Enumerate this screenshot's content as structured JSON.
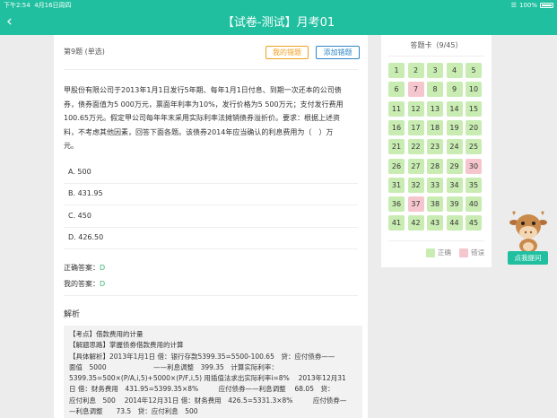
{
  "status": {
    "time": "下午2:54",
    "date": "4月16日周四",
    "battery": "100%"
  },
  "nav": {
    "back": "‹",
    "title": "【试卷-测试】月考01"
  },
  "question": {
    "number": "第9题 (单选)",
    "wrong_button": "我的错题",
    "add_button": "添加错题",
    "stem_lines": [
      "甲股份有限公司于2013年1月1日发行5年期、每年1月1日付息、到期一次还本的公司债",
      "券，债券面值为5 000万元，票面年利率为10%，发行价格为5 500万元；支付发行费用",
      "100.65万元。假定甲公司每年年末采用实际利率法摊销债券溢折价。要求：根据上述资",
      "料，不考虑其他因素，回答下面各题。该债券2014年应当确认的利息费用为（　）万",
      "元。"
    ],
    "options": [
      "A. 500",
      "B. 431.95",
      "C. 450",
      "D. 426.50"
    ],
    "correct_label": "正确答案：",
    "correct_value": "D",
    "mine_label": "我的答案：",
    "mine_value": "D"
  },
  "analysis": {
    "title": "解析",
    "lines": [
      "【考点】借款费用的计量",
      "【解题思路】掌握债券借款费用的计算",
      "【具体解析】2013年1月1日 借：银行存款5399.35=5500-100.65　贷：应付债券——",
      "面值　5000　　　　　　　——利息调整　399.35　计算实际利率：",
      "5399.35=500×(P/A,i,5)+5000×(P/F,i,5) 用插值法求出实际利率i=8%　 2013年12月31",
      "日 借：财务费用　431.95=5399.35×8%　　　应付债券——利息调整　 68.05　贷：",
      "应付利息　500　 2014年12月31日 借：财务费用　426.5=5331.3×8%　　　应付债券—",
      "—利息调整　　73.5　贷：应付利息　500"
    ]
  },
  "answer_card": {
    "title": "答题卡（9/45）",
    "numbers": [
      1,
      2,
      3,
      4,
      5,
      6,
      7,
      8,
      9,
      10,
      11,
      12,
      13,
      14,
      15,
      16,
      17,
      18,
      19,
      20,
      21,
      22,
      23,
      24,
      25,
      26,
      27,
      28,
      29,
      30,
      31,
      32,
      33,
      34,
      35,
      36,
      37,
      38,
      39,
      40,
      41,
      42,
      43,
      44,
      45
    ],
    "wrong": [
      7,
      30,
      37
    ],
    "legend_correct": "正确",
    "legend_wrong": "错误",
    "colors": {
      "correct": "#c9ecb3",
      "wrong": "#f5c6cd"
    }
  },
  "ask": {
    "label": "点我提问"
  },
  "colors": {
    "accent": "#1fbf9f",
    "answer_green": "#3cb371"
  }
}
